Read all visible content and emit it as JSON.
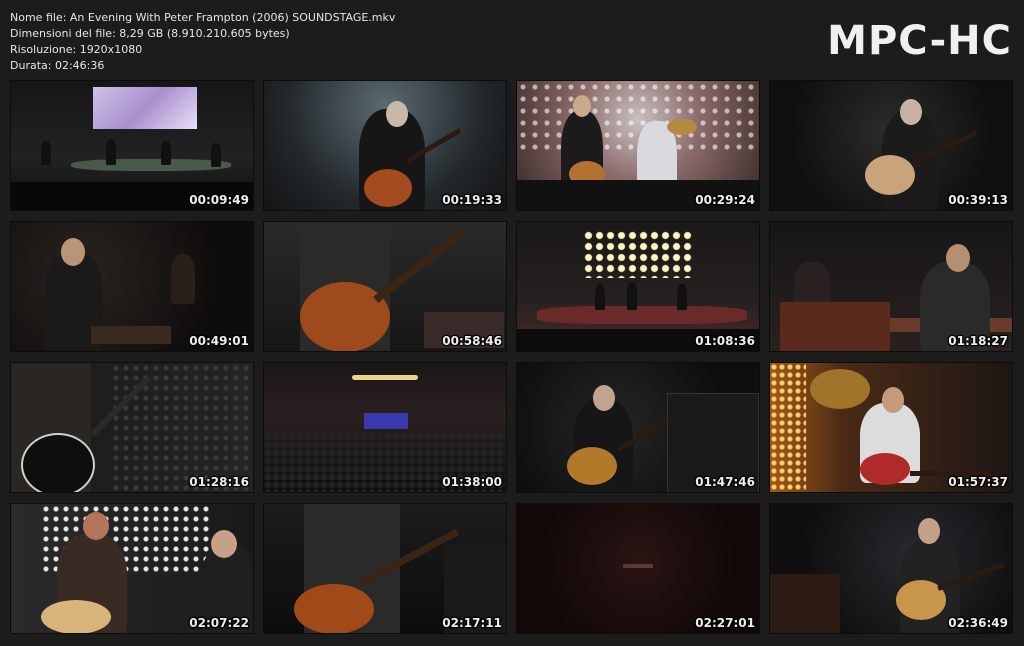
{
  "info": {
    "filename": "Nome file: An Evening With Peter Frampton (2006) SOUNDSTAGE.mkv",
    "filesize": "Dimensioni del file: 8,29 GB (8.910.210.605 bytes)",
    "resolution": "Risoluzione: 1920x1080",
    "duration": "Durata: 02:46:36"
  },
  "logo": "MPC-HC",
  "thumbnails": [
    {
      "time": "00:09:49"
    },
    {
      "time": "00:19:33"
    },
    {
      "time": "00:29:24"
    },
    {
      "time": "00:39:13"
    },
    {
      "time": "00:49:01"
    },
    {
      "time": "00:58:46"
    },
    {
      "time": "01:08:36"
    },
    {
      "time": "01:18:27"
    },
    {
      "time": "01:28:16"
    },
    {
      "time": "01:38:00"
    },
    {
      "time": "01:47:46"
    },
    {
      "time": "01:57:37"
    },
    {
      "time": "02:07:22"
    },
    {
      "time": "02:17:11"
    },
    {
      "time": "02:27:01"
    },
    {
      "time": "02:36:49"
    }
  ]
}
